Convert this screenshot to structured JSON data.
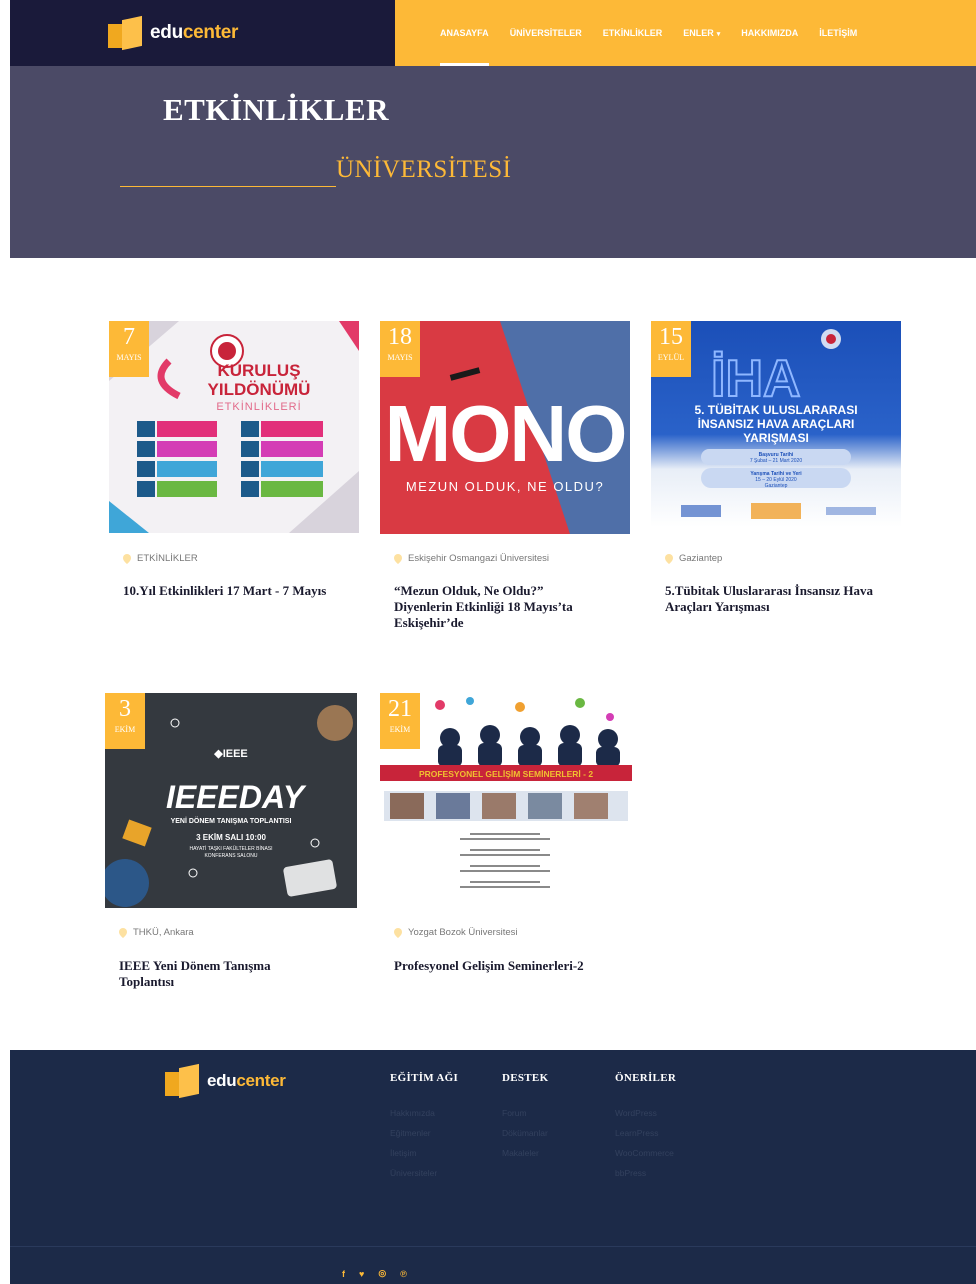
{
  "brand": {
    "edu": "edu",
    "center": "center"
  },
  "nav": {
    "items": [
      {
        "label": "ANASAYFA",
        "active": true
      },
      {
        "label": "ÜNİVERSİTELER",
        "active": false
      },
      {
        "label": "ETKİNLİKLER",
        "active": false
      },
      {
        "label": "ENLER",
        "active": false,
        "caret": "▾"
      },
      {
        "label": "HAKKIMIZDA",
        "active": false
      },
      {
        "label": "İLETİŞİM",
        "active": false
      }
    ]
  },
  "hero": {
    "title": "ETKİNLİKLER",
    "subtitle": "ÜNİVERSİTESİ"
  },
  "events": [
    {
      "day": "7",
      "month": "MAYIS",
      "location": "ETKİNLİKLER",
      "title": "10.Yıl Etkinlikleri 17 Mart - 7 Mayıs",
      "poster": {
        "title1": "KURULUŞ",
        "title2": "YILDÖNÜMÜ",
        "title3": "ETKİNLİKLERİ"
      }
    },
    {
      "day": "18",
      "month": "MAYIS",
      "location": "Eskişehir Osmangazi Üniversitesi",
      "title": "“Mezun Olduk, Ne Oldu?” Diyenlerin Etkinliği 18 Mayıs’ta Eskişehir’de",
      "poster": {
        "word": "MONO",
        "caption": "MEZUN OLDUK, NE OLDU?"
      }
    },
    {
      "day": "15",
      "month": "EYLÜL",
      "location": "Gaziantep",
      "title": "5.Tübitak Uluslararası İnsansız Hava Araçları Yarışması",
      "poster": {
        "word": "İHA",
        "line1": "5. TÜBİTAK ULUSLARARASI",
        "line2": "İNSANSIZ HAVA ARAÇLARI",
        "line3": "YARIŞMASI",
        "box1": "Başvuru Tarihi",
        "box1b": "7 Şubat – 21 Mart 2020",
        "box2": "Yarışma Tarihi ve Yeri",
        "box2b": "15 – 20 Eylül 2020",
        "box2c": "Gaziantep"
      }
    },
    {
      "day": "3",
      "month": "EKİM",
      "location": "THKÜ, Ankara",
      "title": "IEEE Yeni Dönem Tanışma Toplantısı",
      "poster": {
        "org": "◆IEEE",
        "word": "IEEEDAY",
        "line1": "YENİ DÖNEM TANIŞMA TOPLANTISI",
        "line2": "3 EKİM SALI 10:00",
        "line3": "HAYATİ TAŞKI FAKÜLTELER BİNASI",
        "line4": "KONFERANS SALONU"
      }
    },
    {
      "day": "21",
      "month": "EKİM",
      "location": "Yozgat Bozok Üniversitesi",
      "title": "Profesyonel Gelişim Seminerleri-2",
      "poster": {
        "banner": "PROFESYONEL GELİŞİM SEMİNERLERİ - 2"
      }
    }
  ],
  "footer": {
    "columns": [
      {
        "heading": "EĞİTİM AĞI",
        "links": [
          "Hakkımızda",
          "Eğitmenler",
          "İletişim",
          "Üniversiteler"
        ]
      },
      {
        "heading": "DESTEK",
        "links": [
          "Forum",
          "Dökümanlar",
          "Makaleler"
        ]
      },
      {
        "heading": "ÖNERİLER",
        "links": [
          "WordPress",
          "LearnPress",
          "WooCommerce",
          "bbPress"
        ]
      }
    ],
    "socials": [
      {
        "icon": "facebook-icon",
        "glyph": "f"
      },
      {
        "icon": "twitter-icon",
        "glyph": "♥"
      },
      {
        "icon": "instagram-icon",
        "glyph": "◎"
      },
      {
        "icon": "pinterest-icon",
        "glyph": "℗"
      }
    ]
  },
  "colors": {
    "accent": "#fdb937",
    "navy": "#1a1a3a",
    "hero": "#4b4a66",
    "footer": "#1c2a48"
  }
}
